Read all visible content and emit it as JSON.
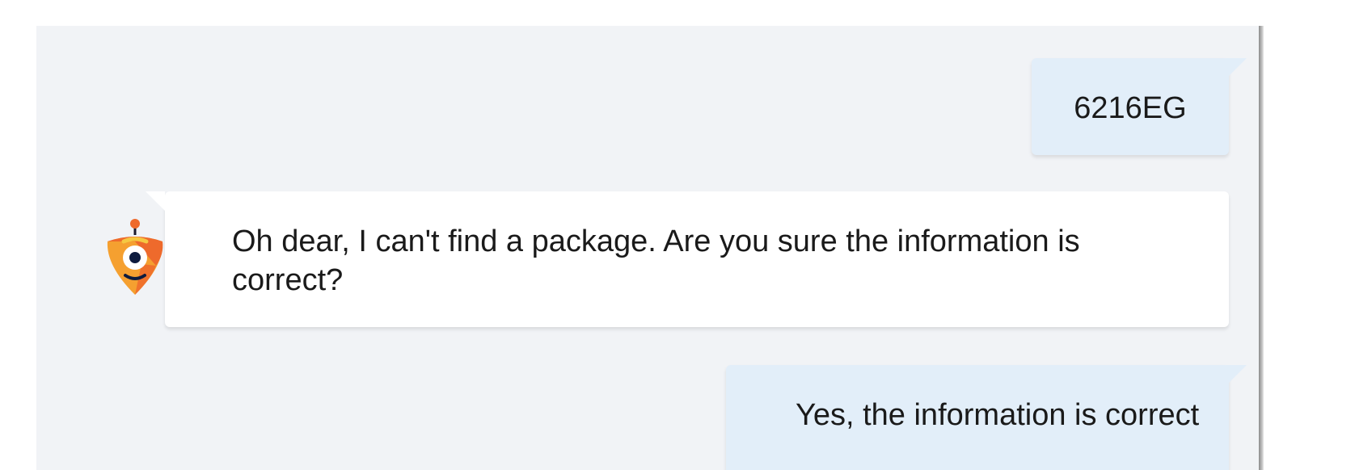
{
  "conversation": {
    "messages": [
      {
        "sender": "user",
        "text": "6216EG"
      },
      {
        "sender": "bot",
        "text": "Oh dear, I can't find a package. Are you sure the information is correct?"
      },
      {
        "sender": "user",
        "text": "Yes, the information is correct"
      }
    ]
  },
  "avatar": {
    "icon": "bot-mascot-icon"
  },
  "colors": {
    "panel_bg": "#f1f3f6",
    "user_bubble": "#e2eef9",
    "bot_bubble": "#ffffff",
    "mascot_orange": "#ee6a2c",
    "mascot_yellow": "#f5a030",
    "mascot_eye": "#0d1b3e"
  }
}
